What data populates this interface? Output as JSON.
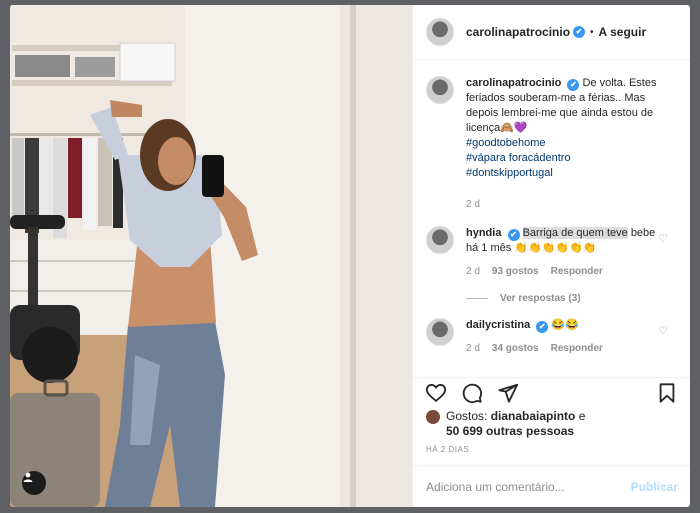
{
  "post": {
    "author": "carolinapatrocinio",
    "verified_mark": "✔",
    "separator": "•",
    "follow_label": "A seguir",
    "caption": "De volta. Estes feriados souberam-me a férias.. Mas depois lembrei-me que ainda estou de licença🙈💜",
    "hashtags": [
      "#goodtobehome",
      "#vápara foracádentro",
      "#dontskipportugal"
    ],
    "caption_time": "2 d"
  },
  "comments": [
    {
      "username": "hyndia",
      "text_highlight": "Barriga de quem teve",
      "text_rest": "bebe há 1 mês 👏👏👏👏👏👏",
      "time": "2 d",
      "likes": "93 gostos",
      "reply": "Responder",
      "view_replies": "Ver respostas (3)"
    },
    {
      "username": "dailycristina",
      "text": "😂😂",
      "time": "2 d",
      "likes": "34 gostos",
      "reply": "Responder"
    }
  ],
  "actions": {
    "icons": [
      "heart-icon",
      "comment-icon",
      "share-icon",
      "bookmark-icon"
    ]
  },
  "likes": {
    "prefix": "Gostos:",
    "liker": "dianabaiapinto",
    "connector": "e",
    "others": "50 699 outras pessoas"
  },
  "ago": "HÁ 2 DIAS",
  "comment_box": {
    "placeholder": "Adiciona um comentário...",
    "publish_label": "Publicar"
  },
  "colors": {
    "accent": "#3897f0",
    "link": "#00376b",
    "publish_disabled": "#b2dffc"
  }
}
